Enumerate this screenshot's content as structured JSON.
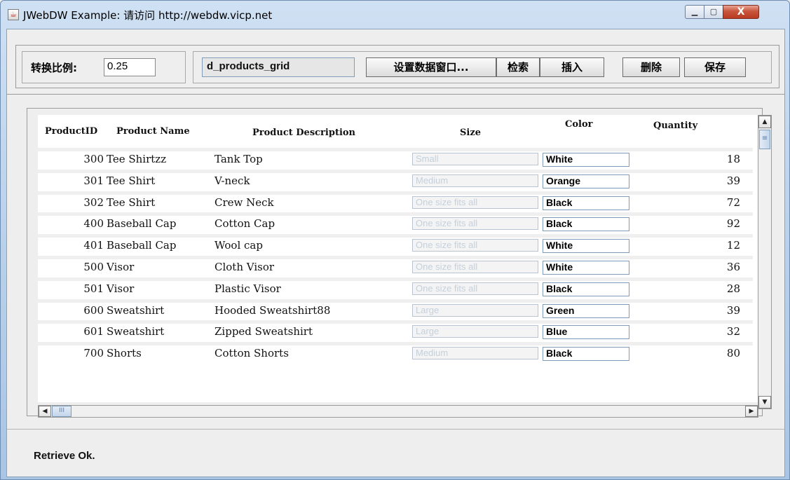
{
  "window": {
    "title": "JWebDW Example: 请访问 http://webdw.vicp.net",
    "icons": {
      "app": "java-cup-icon",
      "minimize": "minimize-icon",
      "maximize": "maximize-icon",
      "close": "close-icon"
    },
    "min_glyph": "▁",
    "max_glyph": "▢",
    "close_glyph": "X"
  },
  "toolbar": {
    "ratio_label": "转换比例:",
    "ratio_value": "0.25",
    "dataobject_name": "d_products_grid",
    "set_dw_label": "设置数据窗口...",
    "retrieve_label": "检索",
    "insert_label": "插入",
    "delete_label": "删除",
    "save_label": "保存"
  },
  "grid": {
    "columns": [
      "ProductID",
      "Product Name",
      "Product Description",
      "Size",
      "Color",
      "Quantity"
    ],
    "rows": [
      {
        "id": "300",
        "name": "Tee Shirtzz",
        "desc": "Tank Top",
        "size": "Small",
        "color": "White",
        "qty": "18"
      },
      {
        "id": "301",
        "name": "Tee Shirt",
        "desc": "V-neck",
        "size": "Medium",
        "color": "Orange",
        "qty": "39"
      },
      {
        "id": "302",
        "name": "Tee Shirt",
        "desc": "Crew Neck",
        "size": "One size fits all",
        "color": "Black",
        "qty": "72"
      },
      {
        "id": "400",
        "name": "Baseball Cap",
        "desc": "Cotton Cap",
        "size": "One size fits all",
        "color": "Black",
        "qty": "92"
      },
      {
        "id": "401",
        "name": "Baseball Cap",
        "desc": "Wool cap",
        "size": "One size fits all",
        "color": "White",
        "qty": "12"
      },
      {
        "id": "500",
        "name": "Visor",
        "desc": "Cloth Visor",
        "size": "One size fits all",
        "color": "White",
        "qty": "36"
      },
      {
        "id": "501",
        "name": "Visor",
        "desc": "Plastic Visor",
        "size": "One size fits all",
        "color": "Black",
        "qty": "28"
      },
      {
        "id": "600",
        "name": "Sweatshirt",
        "desc": "Hooded Sweatshirt88",
        "size": "Large",
        "color": "Green",
        "qty": "39"
      },
      {
        "id": "601",
        "name": "Sweatshirt",
        "desc": "Zipped Sweatshirt",
        "size": "Large",
        "color": "Blue",
        "qty": "32"
      },
      {
        "id": "700",
        "name": "Shorts",
        "desc": "Cotton Shorts",
        "size": "Medium",
        "color": "Black",
        "qty": "80"
      }
    ]
  },
  "scrollbars": {
    "up_glyph": "▲",
    "down_glyph": "▼",
    "left_glyph": "◀",
    "right_glyph": "▶",
    "vthumb_glyph": "≡",
    "hthumb_glyph": "III"
  },
  "status": {
    "text": "Retrieve Ok."
  }
}
